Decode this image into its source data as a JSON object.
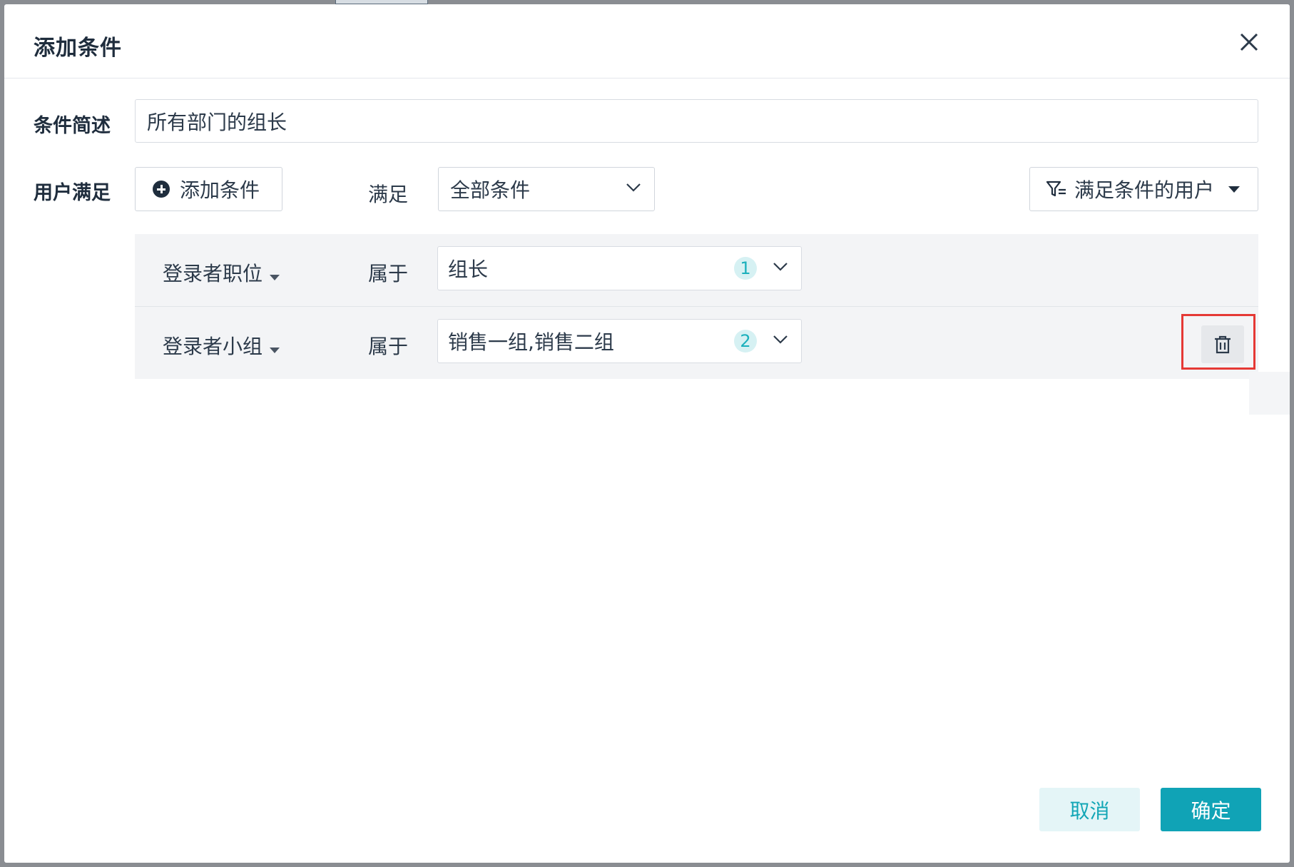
{
  "dialog": {
    "title": "添加条件",
    "close_icon": "close-icon"
  },
  "form": {
    "summary_label": "条件简述",
    "summary_value": "所有部门的组长",
    "users_label": "用户满足",
    "add_condition_label": "添加条件",
    "match_label": "满足",
    "match_select_value": "全部条件",
    "filter_button_label": "满足条件的用户"
  },
  "conditions": [
    {
      "field": "登录者职位",
      "operator": "属于",
      "value": "组长",
      "count": "1"
    },
    {
      "field": "登录者小组",
      "operator": "属于",
      "value": "销售一组,销售二组",
      "count": "2"
    }
  ],
  "footer": {
    "cancel_label": "取消",
    "ok_label": "确定"
  },
  "colors": {
    "accent": "#10a3b6",
    "highlight_border": "#e53935",
    "badge_bg": "#d6f1f3"
  }
}
